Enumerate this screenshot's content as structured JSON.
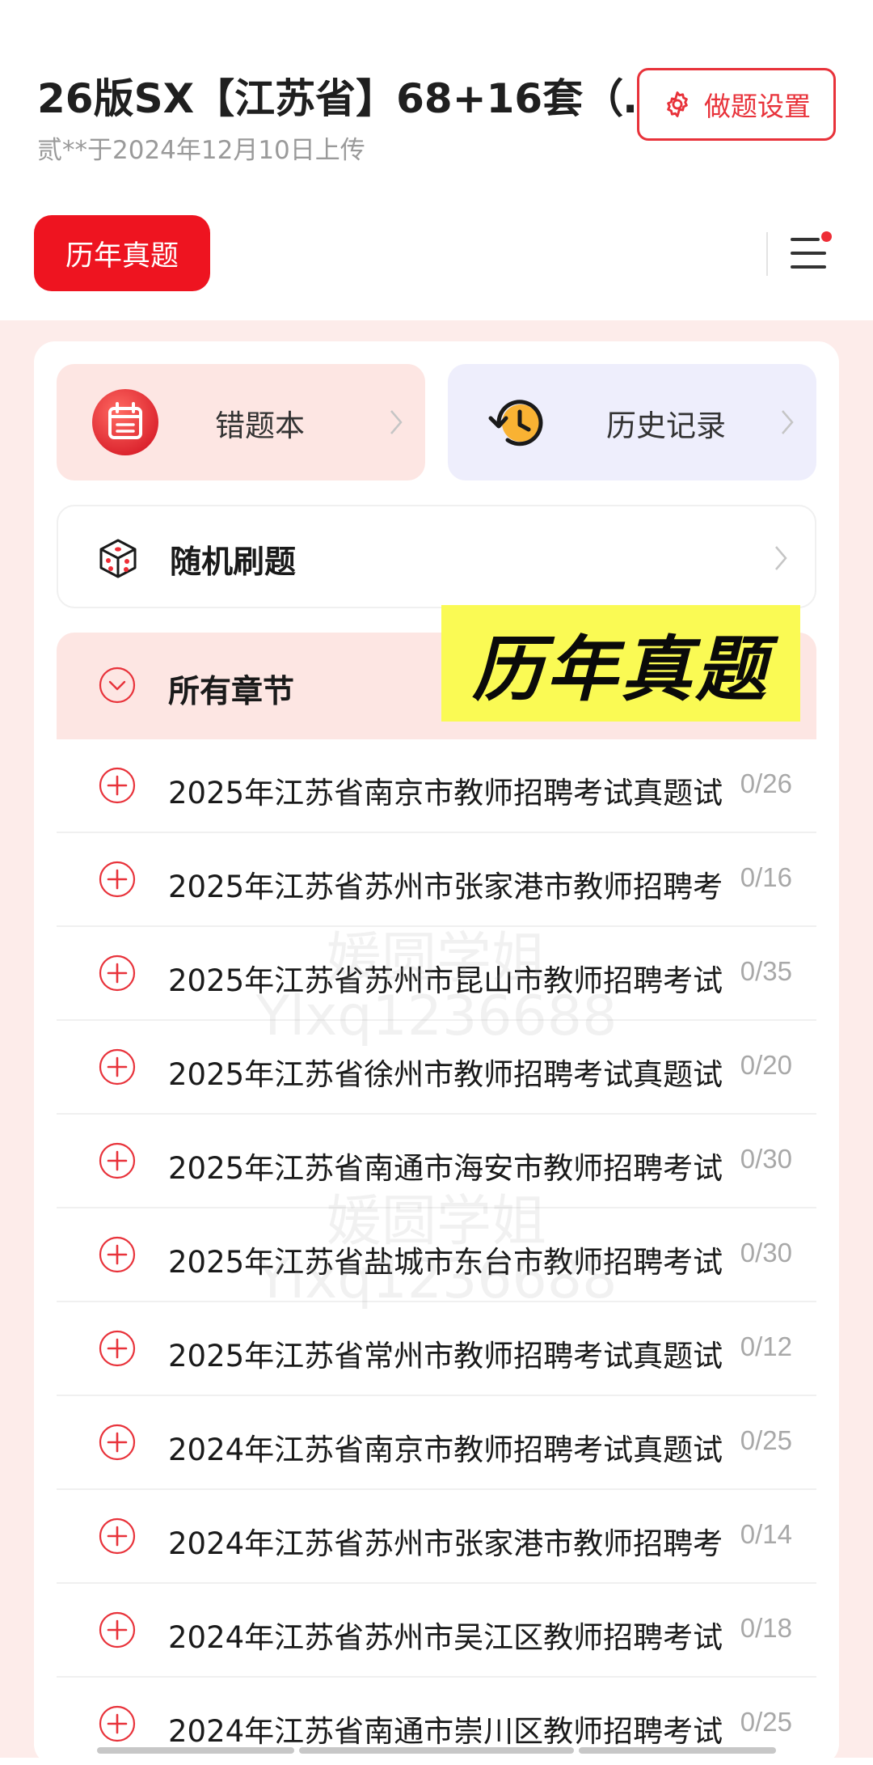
{
  "header": {
    "title": "26版SX【江苏省】68+16套（…",
    "subtitle": "贰**于2024年12月10日上传",
    "settings_label": "做题设置"
  },
  "tabs": {
    "active_label": "历年真题"
  },
  "quick_actions": {
    "wrong_book": "错题本",
    "history": "历史记录"
  },
  "random_practice": "随机刷题",
  "chapters": {
    "header_label": "所有章节",
    "items": [
      {
        "title": "2025年江苏省南京市教师招聘考试真题试",
        "count": "0/26"
      },
      {
        "title": "2025年江苏省苏州市张家港市教师招聘考",
        "count": "0/16"
      },
      {
        "title": "2025年江苏省苏州市昆山市教师招聘考试",
        "count": "0/35"
      },
      {
        "title": "2025年江苏省徐州市教师招聘考试真题试",
        "count": "0/20"
      },
      {
        "title": "2025年江苏省南通市海安市教师招聘考试",
        "count": "0/30"
      },
      {
        "title": "2025年江苏省盐城市东台市教师招聘考试",
        "count": "0/30"
      },
      {
        "title": "2025年江苏省常州市教师招聘考试真题试",
        "count": "0/12"
      },
      {
        "title": "2024年江苏省南京市教师招聘考试真题试",
        "count": "0/25"
      },
      {
        "title": "2024年江苏省苏州市张家港市教师招聘考",
        "count": "0/14"
      },
      {
        "title": "2024年江苏省苏州市吴江区教师招聘考试",
        "count": "0/18"
      },
      {
        "title": "2024年江苏省南通市崇川区教师招聘考试",
        "count": "0/25"
      }
    ]
  },
  "overlay_banner": "历年真题",
  "watermark": {
    "line1": "媛圆学姐",
    "line2": "Ylxq1236688"
  },
  "colors": {
    "accent": "#ee1420",
    "page_tint": "#fdecea",
    "banner": "#fafa54"
  }
}
